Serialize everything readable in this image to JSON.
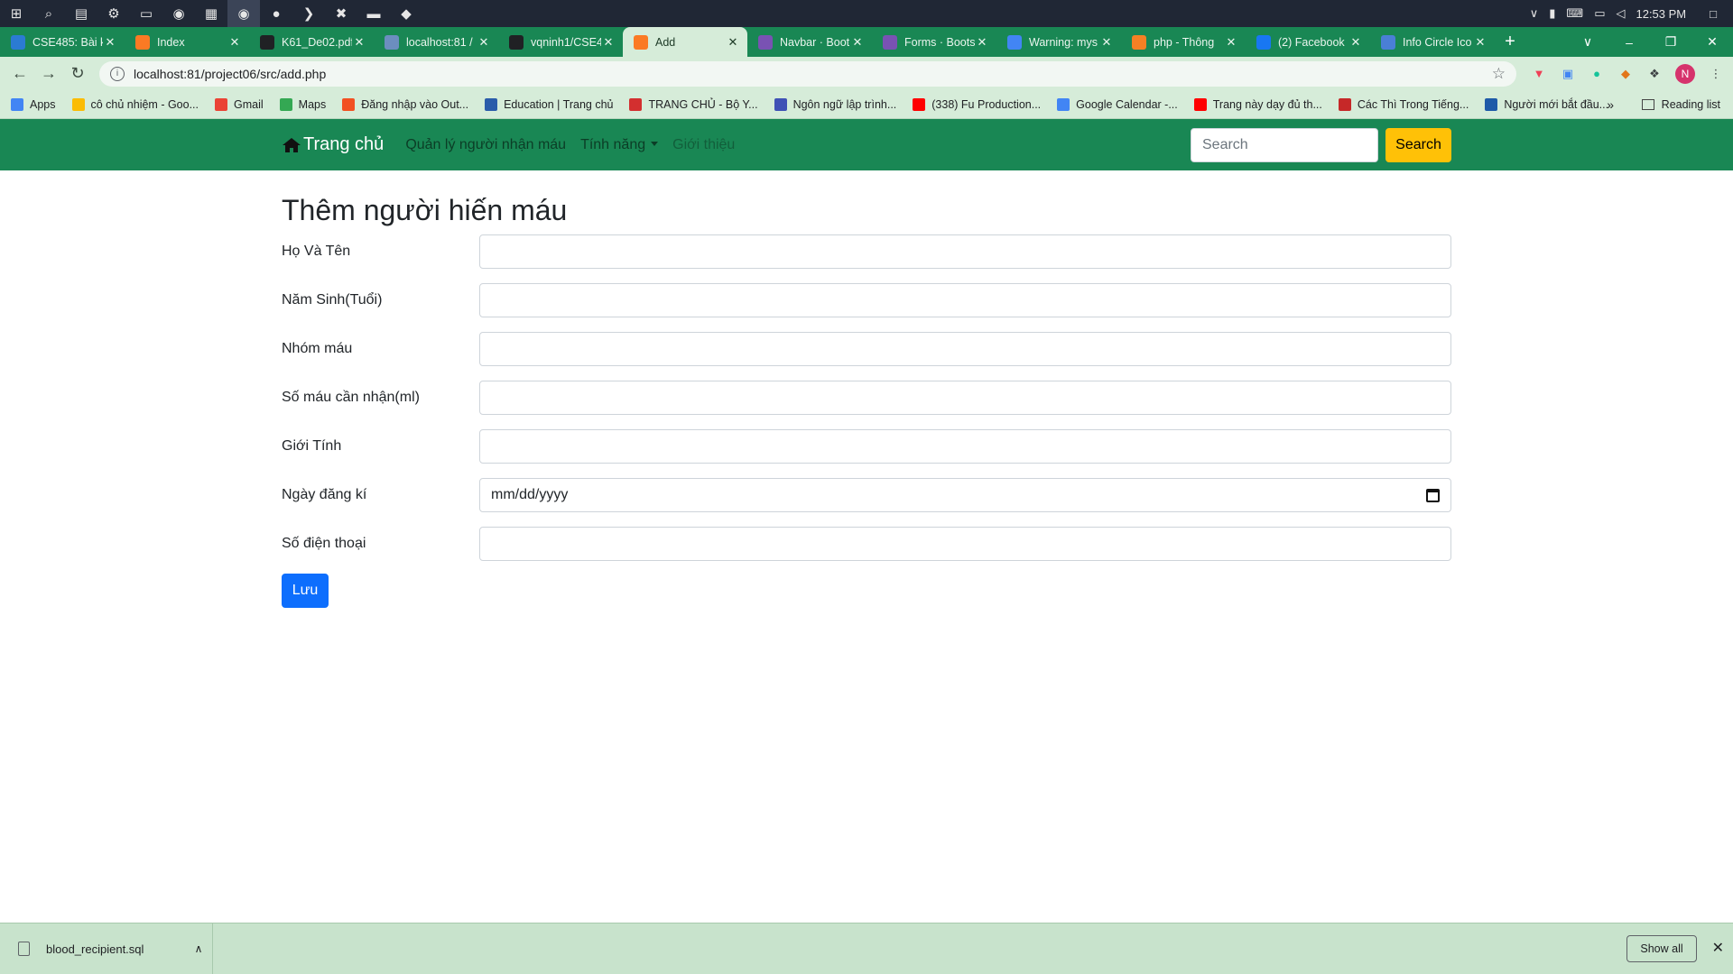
{
  "os": {
    "clock": "12:53 PM",
    "taskbar_icons": [
      "windows-icon",
      "search-icon",
      "task-view-icon",
      "settings-icon",
      "monitor-icon",
      "chrome-icon",
      "app-icon",
      "chrome-active-icon",
      "discord-icon",
      "vscode-icon",
      "xampp-icon",
      "folder-icon",
      "git-icon"
    ]
  },
  "browser": {
    "tabs": [
      {
        "title": "CSE485: Bài k",
        "color": "#2b7bd3",
        "icon": "cse-icon"
      },
      {
        "title": "Index",
        "color": "#fb7a24",
        "icon": "xampp-icon"
      },
      {
        "title": "K61_De02.pdf",
        "color": "#202124",
        "icon": "github-icon"
      },
      {
        "title": "localhost:81 /",
        "color": "#6c8ebf",
        "icon": "phpmyadmin-icon"
      },
      {
        "title": "vqninh1/CSE4",
        "color": "#202124",
        "icon": "github-icon"
      },
      {
        "title": "Add",
        "color": "#fb7a24",
        "icon": "xampp-icon",
        "active": true
      },
      {
        "title": "Navbar · Boot",
        "color": "#7952b3",
        "icon": "bootstrap-icon"
      },
      {
        "title": "Forms · Boots",
        "color": "#7952b3",
        "icon": "bootstrap-icon"
      },
      {
        "title": "Warning: mys",
        "color": "#4285f4",
        "icon": "google-icon"
      },
      {
        "title": "php - Thông",
        "color": "#f48024",
        "icon": "stackoverflow-icon"
      },
      {
        "title": "(2) Facebook",
        "color": "#1877f2",
        "icon": "facebook-icon"
      },
      {
        "title": "Info Circle Ico",
        "color": "#4a7fd6",
        "icon": "flag-icon"
      }
    ],
    "url": "localhost:81/project06/src/add.php",
    "bookmarks": [
      {
        "label": "Apps",
        "color": "#4285f4"
      },
      {
        "label": "cô chủ nhiệm - Goo...",
        "color": "#fbbc04"
      },
      {
        "label": "Gmail",
        "color": "#ea4335"
      },
      {
        "label": "Maps",
        "color": "#34a853"
      },
      {
        "label": "Đăng nhập vào Out...",
        "color": "#f25022"
      },
      {
        "label": "Education | Trang chủ",
        "color": "#2a5caa"
      },
      {
        "label": "TRANG CHỦ - Bộ Y...",
        "color": "#d32f2f"
      },
      {
        "label": "Ngôn ngữ lập trình...",
        "color": "#3f51b5"
      },
      {
        "label": "(338) Fu Production...",
        "color": "#ff0000"
      },
      {
        "label": "Google Calendar -...",
        "color": "#4285f4"
      },
      {
        "label": "Trang này dạy đủ th...",
        "color": "#ff0000"
      },
      {
        "label": "Các Thì Trong Tiếng...",
        "color": "#c62828"
      },
      {
        "label": "Người mới bắt đầu...",
        "color": "#1e5aa8"
      }
    ],
    "bookmarks_more": "»",
    "reading_list": "Reading list",
    "profile_initial": "N"
  },
  "navbar": {
    "brand": "Trang chủ",
    "links": {
      "manage": "Quản lý người nhận máu",
      "features": "Tính năng",
      "about": "Giới thiệu"
    },
    "search_placeholder": "Search",
    "search_button": "Search"
  },
  "form": {
    "title": "Thêm người hiến máu",
    "fields": {
      "name": {
        "label": "Họ Và Tên",
        "value": ""
      },
      "birth": {
        "label": "Năm Sinh(Tuổi)",
        "value": ""
      },
      "blood_group": {
        "label": "Nhóm máu",
        "value": ""
      },
      "amount": {
        "label": "Số máu cần nhận(ml)",
        "value": ""
      },
      "gender": {
        "label": "Giới Tính",
        "value": ""
      },
      "reg_date": {
        "label": "Ngày đăng kí",
        "placeholder": "mm/dd/yyyy"
      },
      "phone": {
        "label": "Số điện thoại",
        "value": ""
      }
    },
    "save_button": "Lưu"
  },
  "downloads": {
    "file": "blood_recipient.sql",
    "show_all": "Show all"
  }
}
